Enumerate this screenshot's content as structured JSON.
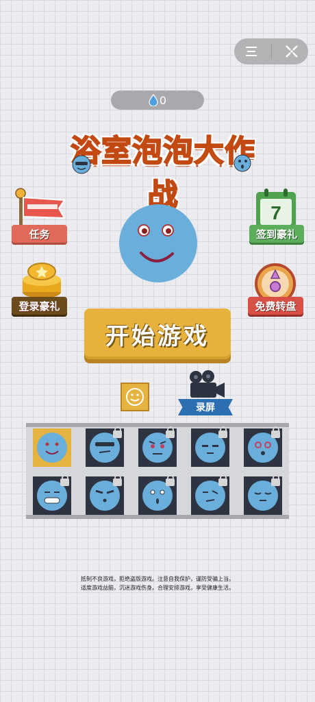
{
  "window": {
    "menu_icon": "menu-icon",
    "close_icon": "close-target-icon"
  },
  "counter": {
    "icon": "water-drop-icon",
    "value": "0"
  },
  "title": "浴室泡泡大作战",
  "left_buttons": [
    {
      "label": "任务",
      "icon": "flag-icon"
    },
    {
      "label": "登录豪礼",
      "icon": "gold-coins-icon"
    }
  ],
  "right_buttons": [
    {
      "label": "签到豪礼",
      "icon": "calendar-icon",
      "calendar_day": "7"
    },
    {
      "label": "免费转盘",
      "icon": "wheel-icon"
    }
  ],
  "start_label": "开始游戏",
  "record_label": "录屏",
  "skins": [
    {
      "expr": "smile",
      "locked": false,
      "selected": true
    },
    {
      "expr": "cool",
      "locked": true
    },
    {
      "expr": "angry",
      "locked": true
    },
    {
      "expr": "blank",
      "locked": true
    },
    {
      "expr": "swirl",
      "locked": true
    },
    {
      "expr": "grin",
      "locked": true
    },
    {
      "expr": "stern",
      "locked": true
    },
    {
      "expr": "surprised",
      "locked": true
    },
    {
      "expr": "doubt",
      "locked": true
    },
    {
      "expr": "sleepy",
      "locked": true
    }
  ],
  "footer": [
    "抵制不良游戏，拒绝盗版游戏。注意自我保护，谨防受骗上当。",
    "适度游戏益脑，沉迷游戏伤身。合理安排游戏，享受健康生活。"
  ],
  "colors": {
    "face": "#6aaedb",
    "gold": "#e6b23d",
    "panel": "#d6d7db"
  }
}
